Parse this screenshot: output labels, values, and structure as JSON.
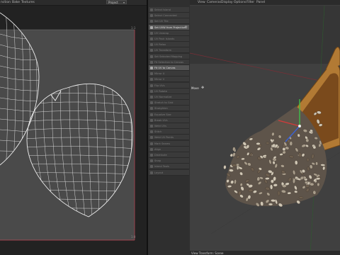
{
  "uv_editor": {
    "menu": [
      "nction",
      "Bake",
      "Textures"
    ],
    "view_dropdown": "Project",
    "corners": {
      "top_right": "1:1",
      "bottom_right": "1:0"
    },
    "controls": [
      "+",
      "≡",
      "⌂"
    ]
  },
  "tool_panel": {
    "buttons": [
      {
        "label": "Select Island",
        "active": false
      },
      {
        "label": "Select Connected",
        "active": false
      },
      {
        "label": "Set UV Tile",
        "active": false
      },
      {
        "label": "Set UVW from Projection",
        "active": true,
        "gear": true
      },
      {
        "label": "UV Unwrap",
        "active": false
      },
      {
        "label": "UV Pack Islands",
        "active": false
      },
      {
        "label": "UV Relax",
        "active": false
      },
      {
        "label": "UV Transform",
        "active": false
      },
      {
        "label": "Set Selected Mapping",
        "active": false
      },
      {
        "label": "Fit Selection to Canvas",
        "active": false
      },
      {
        "label": "Fit UV to Canvas",
        "active": true
      },
      {
        "label": "Mirror U",
        "active": false
      },
      {
        "label": "Mirror V",
        "active": false
      },
      {
        "label": "Flip UVs",
        "active": false
      },
      {
        "label": "UV Rotate",
        "active": false
      },
      {
        "label": "UV Normalize",
        "active": false
      },
      {
        "label": "Stretch to Grid",
        "active": false
      },
      {
        "label": "Straighten",
        "active": false
      },
      {
        "label": "Equalize Size",
        "active": false
      },
      {
        "label": "Break UVs",
        "active": false
      },
      {
        "label": "Weld UVs",
        "active": false
      },
      {
        "label": "Stitch",
        "active": false
      },
      {
        "label": "Weld UV Points",
        "active": false
      },
      {
        "label": "Mark Seams",
        "active": false
      },
      {
        "label": "Align",
        "active": false
      },
      {
        "label": "Distribute",
        "active": false
      },
      {
        "label": "Snap",
        "active": false
      },
      {
        "label": "Island Tools",
        "active": false
      },
      {
        "label": "Layout",
        "active": false
      }
    ]
  },
  "viewport": {
    "menu": [
      "View",
      "Cameras",
      "Display",
      "Options",
      "Filter",
      "Panel"
    ],
    "view_name": "Perspective",
    "camera": "Default Camera ⊙",
    "move_label": "Move",
    "move_icon": "move-icon",
    "status": "View Transform: Scene"
  },
  "colors": {
    "uv_grid": "#e8e8e8",
    "uv_bounds": "#c04a5a",
    "wood": "#a8722f",
    "bean": "#cfc6b4"
  }
}
